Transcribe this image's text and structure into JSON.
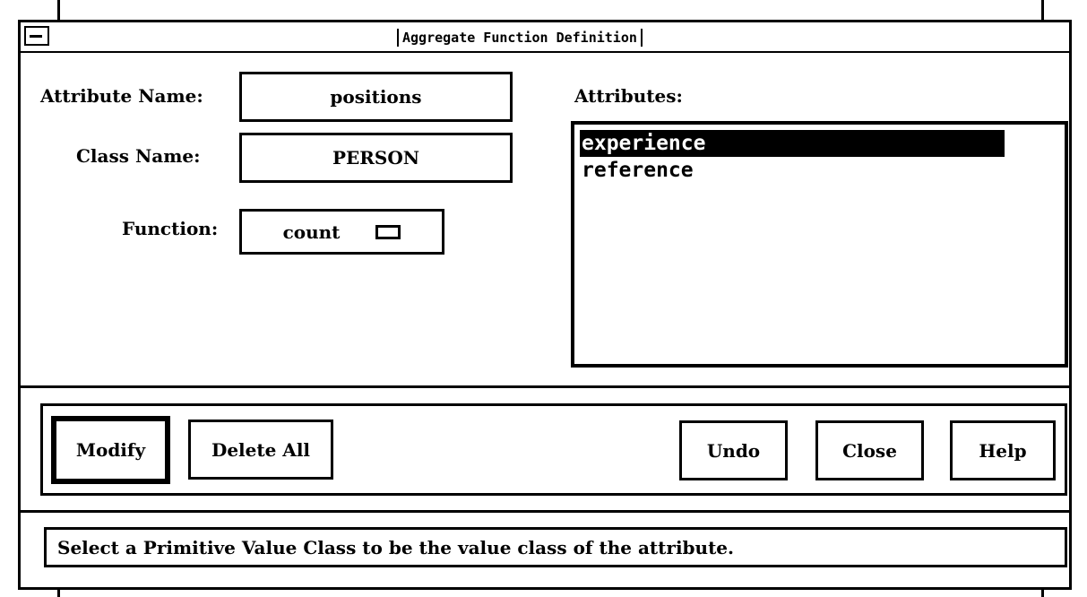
{
  "window": {
    "title": "Aggregate Function Definition"
  },
  "form": {
    "attribute_name_label": "Attribute Name:",
    "attribute_name_value": "positions",
    "class_name_label": "Class Name:",
    "class_name_value": "PERSON",
    "function_label": "Function:",
    "function_value": "count"
  },
  "attributes": {
    "label": "Attributes:",
    "items": [
      {
        "label": "experience",
        "selected": true
      },
      {
        "label": "reference",
        "selected": false
      }
    ]
  },
  "buttons": {
    "modify": "Modify",
    "delete_all": "Delete All",
    "undo": "Undo",
    "close": "Close",
    "help": "Help"
  },
  "status": {
    "message": "Select a Primitive Value Class to be the value class of the attribute."
  }
}
